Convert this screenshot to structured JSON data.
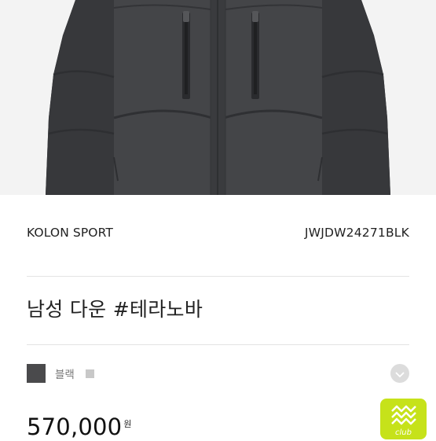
{
  "product": {
    "brand": "KOLON SPORT",
    "sku": "JWJDW24271BLK",
    "title": "남성 다운 #테라노바",
    "color": {
      "name": "블랙",
      "swatch_hex": "#4a4a4c"
    },
    "price": "570,000",
    "currency": "원"
  },
  "badge": {
    "label": "club",
    "color": "#c6e21a"
  },
  "icons": {
    "expand": "chevron-down-icon",
    "badge": "club-badge-icon"
  }
}
